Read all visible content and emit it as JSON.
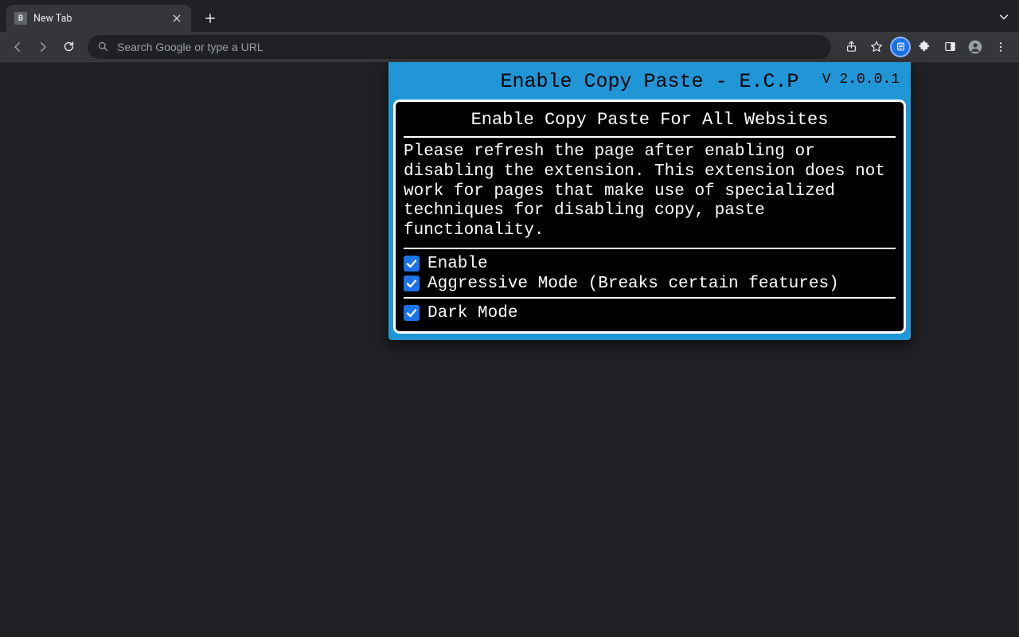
{
  "tab": {
    "favicon_letter": "B",
    "title": "New Tab"
  },
  "omnibox": {
    "placeholder": "Search Google or type a URL"
  },
  "extension": {
    "title": "Enable Copy Paste - E.C.P",
    "version": "V 2.0.0.1",
    "subtitle": "Enable Copy Paste For All Websites",
    "description": "Please refresh the page after enabling or disabling the extension. This extension does not work for pages that make use of specialized techniques for disabling copy, paste functionality.",
    "options": {
      "enable": {
        "label": "Enable",
        "checked": true
      },
      "aggressive": {
        "label": "Aggressive Mode (Breaks certain features)",
        "checked": true
      },
      "dark": {
        "label": "Dark Mode",
        "checked": true
      }
    }
  }
}
